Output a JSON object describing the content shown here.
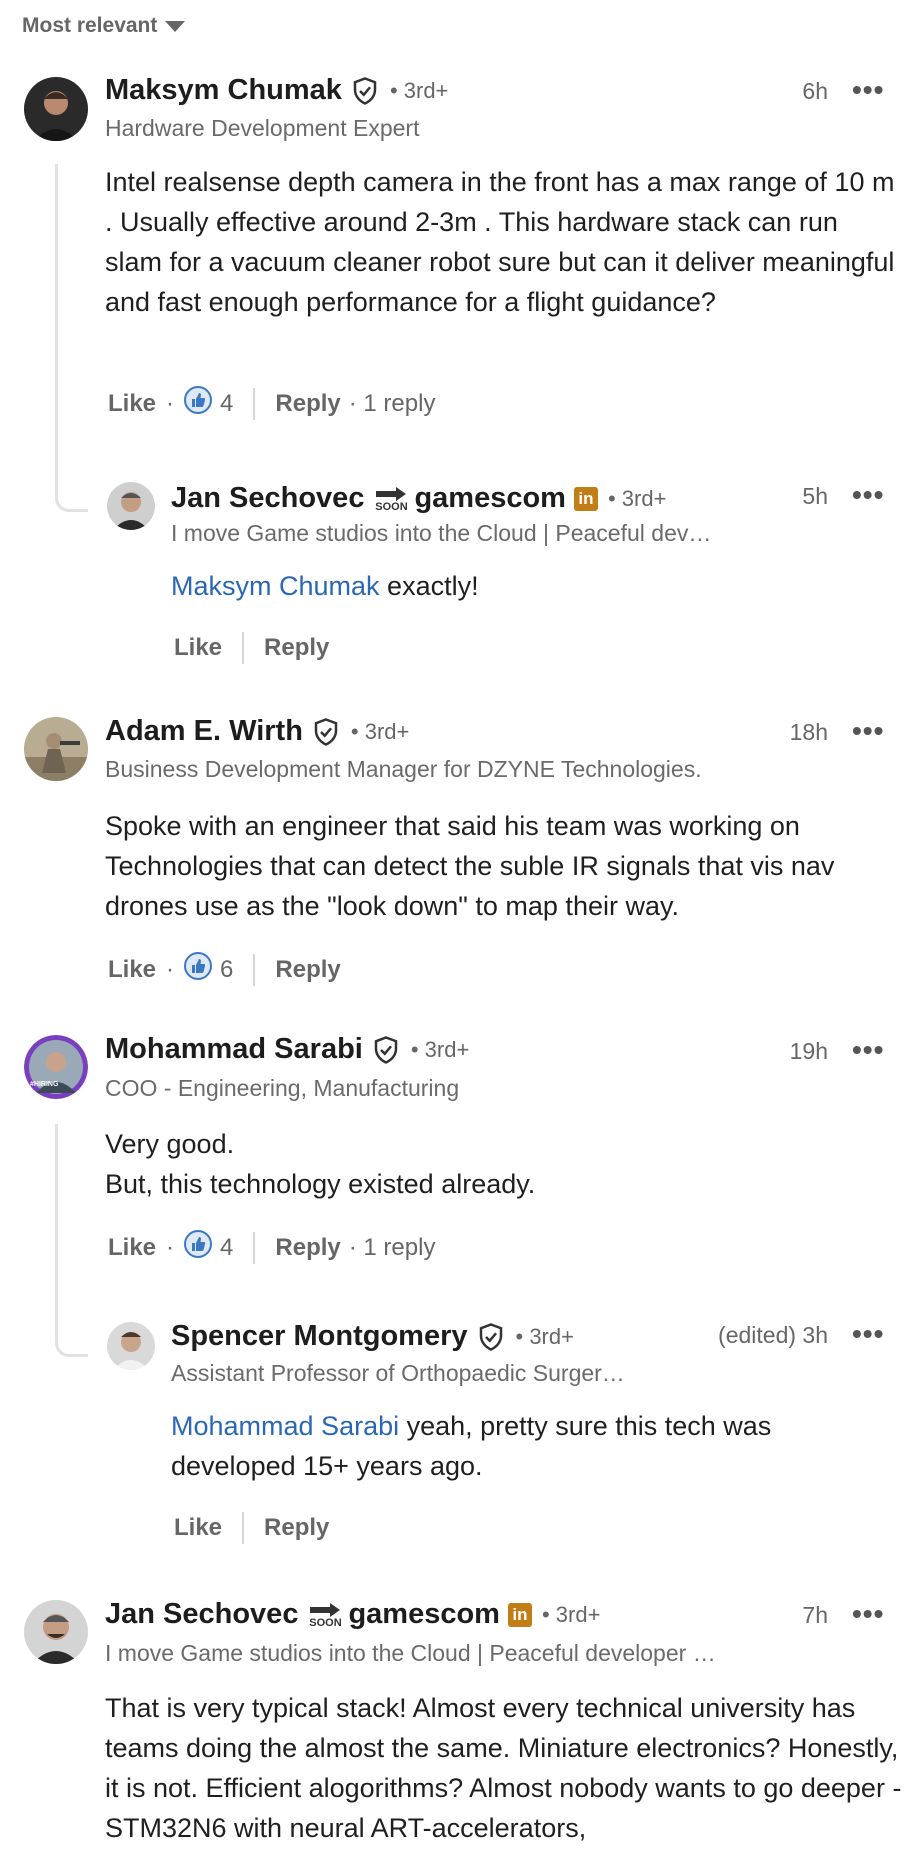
{
  "sort": {
    "label": "Most relevant"
  },
  "icons": {
    "more": "more-horizontal-icon",
    "verified": "verified-shield-icon",
    "like": "thumbs-up-reaction-icon",
    "linkedin": "linkedin-badge-icon",
    "arrow": "arrow-right-icon"
  },
  "colors": {
    "mention": "#2a67b6",
    "like_reaction": "#3b78c4",
    "linkedin_badge": "#c37d16",
    "hiring_ring": "#7a3fbf"
  },
  "comments": [
    {
      "author": "Maksym Chumak",
      "degree": "• 3rd+",
      "headline": "Hardware Development Expert",
      "time": "6h",
      "text": "Intel realsense depth camera in the front has a max range of 10 m . Usually effective around 2-3m . This hardware stack can run slam for a vacuum cleaner robot sure but can it deliver meaningful and fast enough performance for a flight guidance?",
      "like": "Like",
      "dot": "·",
      "likes": "4",
      "reply": "Reply",
      "replies": "· 1 reply",
      "reply_item": {
        "author": "Jan Sechovec",
        "soon": "SOON",
        "brand": "gamescom",
        "li": "in",
        "degree": "• 3rd+",
        "headline": "I move Game studios into the Cloud | Peaceful dev…",
        "time": "5h",
        "mention": "Maksym Chumak",
        "text": " exactly!",
        "like": "Like",
        "reply": "Reply"
      }
    },
    {
      "author": "Adam E. Wirth",
      "degree": "• 3rd+",
      "headline": "Business Development Manager for DZYNE Technologies.",
      "time": "18h",
      "text": "Spoke with an engineer that said his team was working on Technologies that can detect the suble IR signals that vis nav drones use as the \"look down\" to map their way.",
      "like": "Like",
      "dot": "·",
      "likes": "6",
      "reply": "Reply"
    },
    {
      "author": "Mohammad Sarabi",
      "degree": "• 3rd+",
      "headline": "COO - Engineering, Manufacturing",
      "time": "19h",
      "avatar_badge": "#HIRING",
      "text_line1": "Very good.",
      "text_line2": "But, this technology existed already.",
      "like": "Like",
      "dot": "·",
      "likes": "4",
      "reply": "Reply",
      "replies": "· 1 reply",
      "reply_item": {
        "author": "Spencer Montgomery",
        "degree": "• 3rd+",
        "headline": "Assistant Professor of Orthopaedic Surger…",
        "time": "(edited) 3h",
        "mention": "Mohammad Sarabi",
        "text": " yeah, pretty sure this tech was developed 15+ years ago.",
        "like": "Like",
        "reply": "Reply"
      }
    },
    {
      "author": "Jan Sechovec",
      "soon": "SOON",
      "brand": "gamescom",
      "li": "in",
      "degree": "• 3rd+",
      "headline": "I move Game studios into the Cloud | Peaceful developer …",
      "time": "7h",
      "text": "That is very typical stack! Almost every technical university has teams doing the almost the same. Miniature electronics? Honestly, it is not. Efficient alogorithms? Almost nobody wants to go deeper - STM32N6 with neural ART-accelerators,"
    }
  ]
}
